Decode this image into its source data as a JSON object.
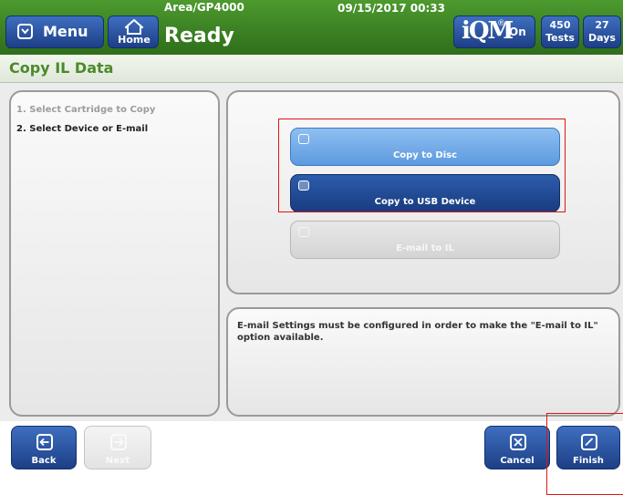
{
  "header": {
    "menu_label": "Menu",
    "home_label": "Home",
    "area": "Area/GP4000",
    "status": "Ready",
    "datetime": "09/15/2017 00:33",
    "iqm_logo": "iQM",
    "iqm_reg": "®",
    "iqm_state": "On",
    "tests_count": "450",
    "tests_label": "Tests",
    "days_count": "27",
    "days_label": "Days"
  },
  "page": {
    "title": "Copy IL Data"
  },
  "steps": [
    {
      "label": "1. Select Cartridge to Copy",
      "state": "done"
    },
    {
      "label": "2. Select Device or E-mail",
      "state": "current"
    }
  ],
  "options": [
    {
      "label": "Copy to Disc",
      "state": "enabled"
    },
    {
      "label": "Copy to USB Device",
      "state": "selected"
    },
    {
      "label": "E-mail to IL",
      "state": "disabled"
    }
  ],
  "message": "E-mail Settings must be configured in order to make the \"E-mail to IL\" option available.",
  "footer": {
    "back_label": "Back",
    "next_label": "Next",
    "cancel_label": "Cancel",
    "finish_label": "Finish"
  },
  "colors": {
    "header_green": "#3a7f22",
    "button_blue": "#1d3f86",
    "title_green": "#4a8a2a",
    "highlight_red": "#e01515"
  }
}
